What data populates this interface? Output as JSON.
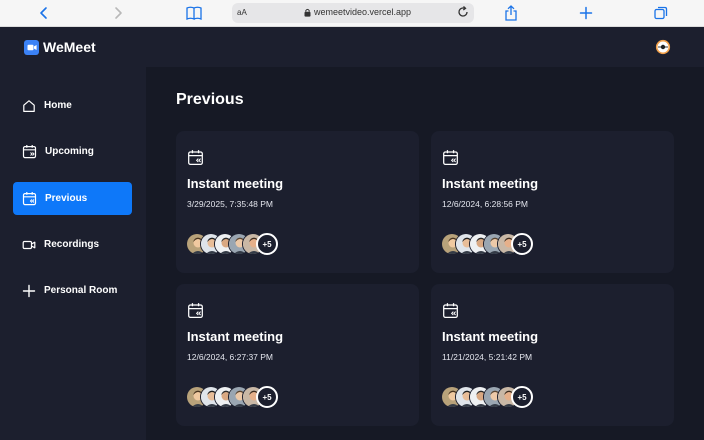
{
  "browser": {
    "text_size_label": "aA",
    "url": "wemeetvideo.vercel.app"
  },
  "app": {
    "name": "WeMeet"
  },
  "sidebar": {
    "items": [
      {
        "label": "Home",
        "icon": "home-icon",
        "active": false
      },
      {
        "label": "Upcoming",
        "icon": "calendar-upcoming-icon",
        "active": false
      },
      {
        "label": "Previous",
        "icon": "calendar-previous-icon",
        "active": true
      },
      {
        "label": "Recordings",
        "icon": "video-icon",
        "active": false
      },
      {
        "label": "Personal Room",
        "icon": "plus-icon",
        "active": false
      }
    ]
  },
  "main": {
    "title": "Previous",
    "meetings": [
      {
        "title": "Instant meeting",
        "date": "3/29/2025, 7:35:48 PM",
        "more": "+5"
      },
      {
        "title": "Instant meeting",
        "date": "12/6/2024, 6:28:56 PM",
        "more": "+5"
      },
      {
        "title": "Instant meeting",
        "date": "12/6/2024, 6:27:37 PM",
        "more": "+5"
      },
      {
        "title": "Instant meeting",
        "date": "11/21/2024, 5:21:42 PM",
        "more": "+5"
      }
    ]
  },
  "colors": {
    "background": "#161925",
    "surface": "#1c1f2e",
    "accent": "#0e78f9"
  }
}
